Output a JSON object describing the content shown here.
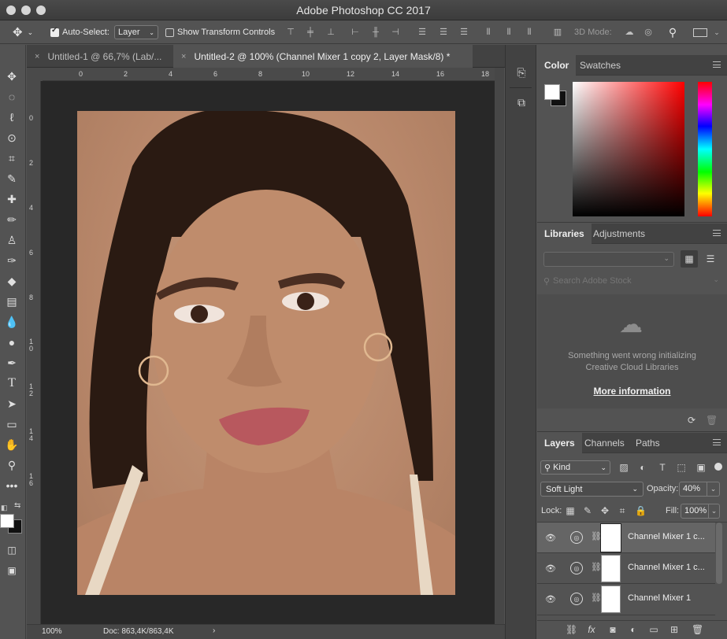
{
  "app": {
    "title": "Adobe Photoshop CC 2017"
  },
  "options": {
    "auto_select_label": "Auto-Select:",
    "auto_select_value": "Layer",
    "show_transform_label": "Show Transform Controls",
    "mode_label": "3D Mode:"
  },
  "tabs": [
    {
      "label": "Untitled-1 @ 66,7% (Lab/...",
      "close": "×"
    },
    {
      "label": "Untitled-2 @ 100% (Channel Mixer 1 copy 2, Layer Mask/8) *",
      "close": "×"
    }
  ],
  "ruler": {
    "h": [
      "0",
      "2",
      "4",
      "6",
      "8",
      "10",
      "12",
      "14",
      "16",
      "18"
    ],
    "v": [
      "0",
      "2",
      "4",
      "6",
      "8",
      "10",
      "12",
      "14",
      "16"
    ]
  },
  "status": {
    "zoom": "100%",
    "doc": "Doc: 863,4K/863,4K",
    "arrow": "›"
  },
  "color_panel": {
    "tabs": [
      "Color",
      "Swatches"
    ]
  },
  "libraries_panel": {
    "tabs": [
      "Libraries",
      "Adjustments"
    ],
    "search_placeholder": "Search Adobe Stock",
    "error_line1": "Something went wrong initializing",
    "error_line2": "Creative Cloud Libraries",
    "more_info": "More information"
  },
  "layers_panel": {
    "tabs": [
      "Layers",
      "Channels",
      "Paths"
    ],
    "filter_kind": "Kind",
    "blend_mode": "Soft Light",
    "opacity_label": "Opacity:",
    "opacity_value": "40%",
    "lock_label": "Lock:",
    "fill_label": "Fill:",
    "fill_value": "100%",
    "layers": [
      {
        "name": "Channel Mixer 1 c...",
        "selected": true
      },
      {
        "name": "Channel Mixer 1 c...",
        "selected": false
      },
      {
        "name": "Channel Mixer 1",
        "selected": false
      }
    ]
  },
  "colors": {
    "accent": "#ff0000",
    "bg": "#535353",
    "panel_dark": "#424242"
  }
}
